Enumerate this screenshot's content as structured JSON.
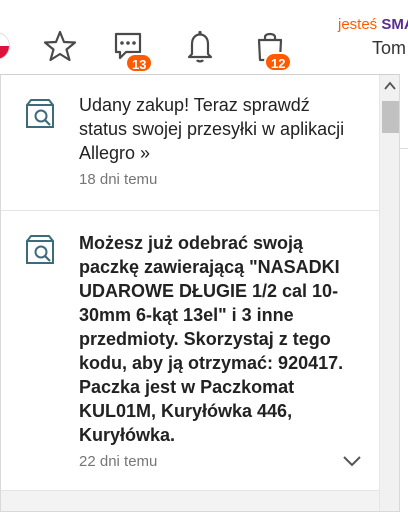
{
  "header": {
    "promo_prefix": "jesteś",
    "promo_brand": "SMA",
    "user_name": "Tom",
    "messages_badge": "13",
    "cart_badge": "12",
    "icons": [
      "star-icon",
      "chat-icon",
      "bell-icon",
      "shopping-bag-icon"
    ]
  },
  "notifications": [
    {
      "icon": "package-search-icon",
      "text": "Udany zakup! Teraz sprawdź status swojej przesyłki w aplikacji Allegro »",
      "time": "18 dni temu"
    },
    {
      "icon": "package-search-icon",
      "text": "Możesz już odebrać swoją paczkę zawierającą \"NASADKI UDAROWE DŁUGIE 1/2 cal 10-30mm 6-kąt 13el\" i 3 inne przedmioty. Skorzystaj z tego kodu, aby ją otrzymać: 920417. Paczka jest w Paczkomat KUL01M, Kuryłówka 446, Kuryłówka.",
      "time": "22 dni temu"
    }
  ],
  "colors": {
    "accent": "#ff5a00",
    "brand_purple": "#5b2d90",
    "icon_gray": "#4a4a4a",
    "icon_teal": "#3d6b7a"
  }
}
